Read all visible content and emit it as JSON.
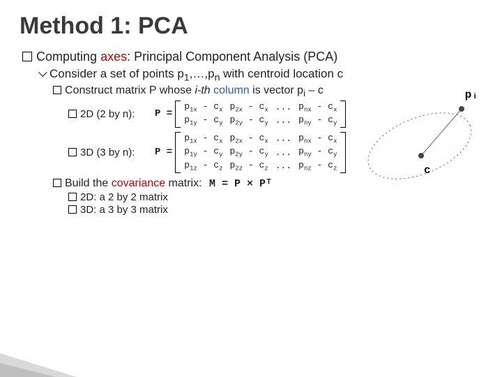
{
  "title": "Method 1: PCA",
  "bullet1": {
    "pre": "Computing ",
    "red": "axes",
    "post": ": Principal Component Analysis (PCA)"
  },
  "consider": {
    "pre": "Consider a set of points p",
    "mid": ",…,p",
    "post": " with centroid location c"
  },
  "construct": {
    "pre": "Construct matrix P whose ",
    "ith": "i-th",
    "col": " column",
    "post": " is vector p",
    "tail": " – c"
  },
  "row2d_label": "2D (2 by n): ",
  "row3d_label": "3D (3 by n): ",
  "peq": "P =",
  "matrix2d": [
    [
      "p1x - cx",
      "p2x - cx",
      "...",
      "pnx - cx"
    ],
    [
      "p1y - cy",
      "p2y - cy",
      "...",
      "pny - cy"
    ]
  ],
  "matrix3d": [
    [
      "p1x - cx",
      "p2x - cx",
      "...",
      "pnx - cx"
    ],
    [
      "p1y - cy",
      "p2y - cy",
      "...",
      "pny - cy"
    ],
    [
      "p1z - cz",
      "p2z - cz",
      "...",
      "pnz - cz"
    ]
  ],
  "build": {
    "pre": "Build the ",
    "cov": "covariance",
    "post": " matrix: "
  },
  "cov_formula": "M = P × Pᵀ",
  "sub2d": "2D: a 2 by 2 matrix",
  "sub3d": "3D: a 3 by 3 matrix",
  "fig": {
    "pi": "pᵢ",
    "c": "c"
  },
  "sub": {
    "one": "1",
    "n": "n",
    "i": "i"
  }
}
